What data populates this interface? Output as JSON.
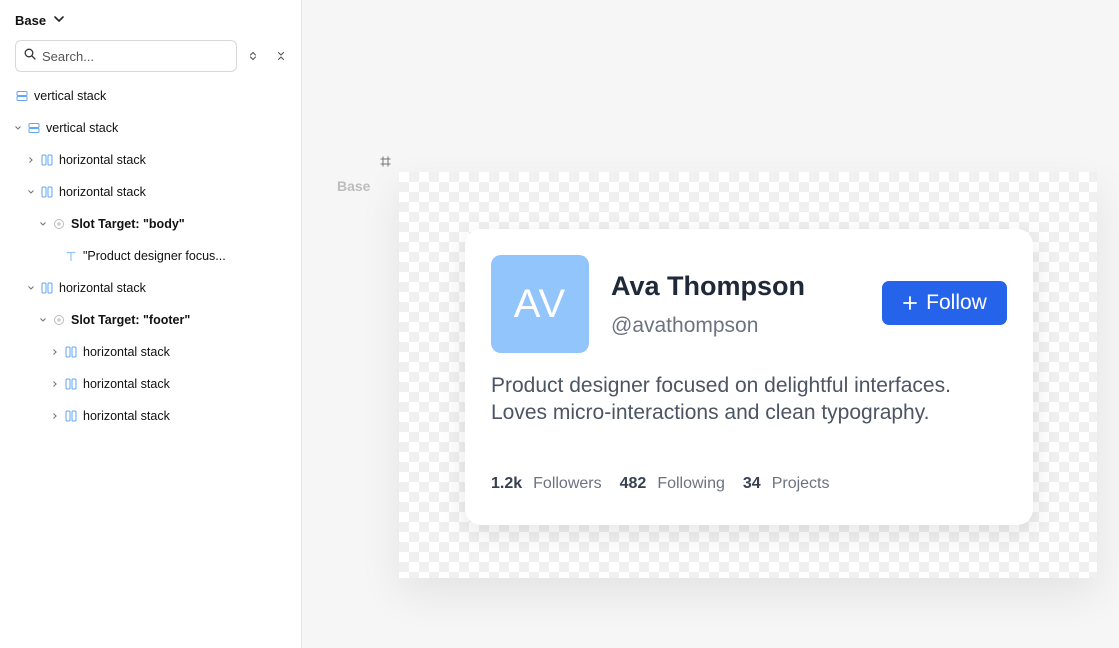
{
  "sidebar": {
    "title": "Base",
    "search_placeholder": "Search...",
    "tree": [
      {
        "label": "vertical stack",
        "icon": "vertical-stack-icon",
        "chevron": ""
      },
      {
        "label": "vertical stack",
        "icon": "vertical-stack-icon",
        "chevron": "down"
      },
      {
        "label": "horizontal stack",
        "icon": "horizontal-stack-icon",
        "chevron": "right"
      },
      {
        "label": "horizontal stack",
        "icon": "horizontal-stack-icon",
        "chevron": "down"
      },
      {
        "label": "Slot Target: \"body\"",
        "icon": "slot-target-icon",
        "chevron": "down"
      },
      {
        "label": "\"Product designer focus...",
        "icon": "text-icon",
        "chevron": ""
      },
      {
        "label": "horizontal stack",
        "icon": "horizontal-stack-icon",
        "chevron": "down"
      },
      {
        "label": "Slot Target: \"footer\"",
        "icon": "slot-target-icon",
        "chevron": "down"
      },
      {
        "label": "horizontal stack",
        "icon": "horizontal-stack-icon",
        "chevron": "right"
      },
      {
        "label": "horizontal stack",
        "icon": "horizontal-stack-icon",
        "chevron": "right"
      },
      {
        "label": "horizontal stack",
        "icon": "horizontal-stack-icon",
        "chevron": "right"
      }
    ]
  },
  "canvas": {
    "frame_label": "Base",
    "card": {
      "avatar_initials": "AV",
      "name": "Ava Thompson",
      "handle": "@avathompson",
      "follow_label": "Follow",
      "bio": "Product designer focused on delightful interfaces. Loves micro-interactions and clean typography.",
      "stats": [
        {
          "value": "1.2k",
          "label": "Followers"
        },
        {
          "value": "482",
          "label": "Following"
        },
        {
          "value": "34",
          "label": "Projects"
        }
      ]
    }
  },
  "colors": {
    "accent": "#2563eb",
    "avatar_bg": "#93c5fd",
    "icon_blue": "#60a5fa"
  }
}
